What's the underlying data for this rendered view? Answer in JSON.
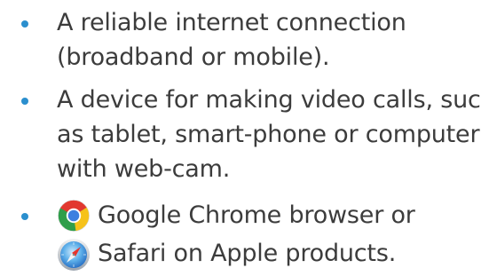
{
  "colors": {
    "text": "#3c3c3c",
    "bullet": "#2b8fce",
    "background": "#ffffff"
  },
  "items": [
    {
      "lines": [
        "A reliable internet connection",
        "(broadband or mobile)."
      ]
    },
    {
      "lines": [
        "A device for making video calls, such",
        "as tablet, smart-phone or computer",
        "with web-cam."
      ]
    },
    {
      "icon": "chrome-icon",
      "lines": [
        "Google Chrome browser or"
      ]
    },
    {
      "icon": "safari-icon",
      "lines": [
        "Safari on Apple products."
      ]
    }
  ]
}
